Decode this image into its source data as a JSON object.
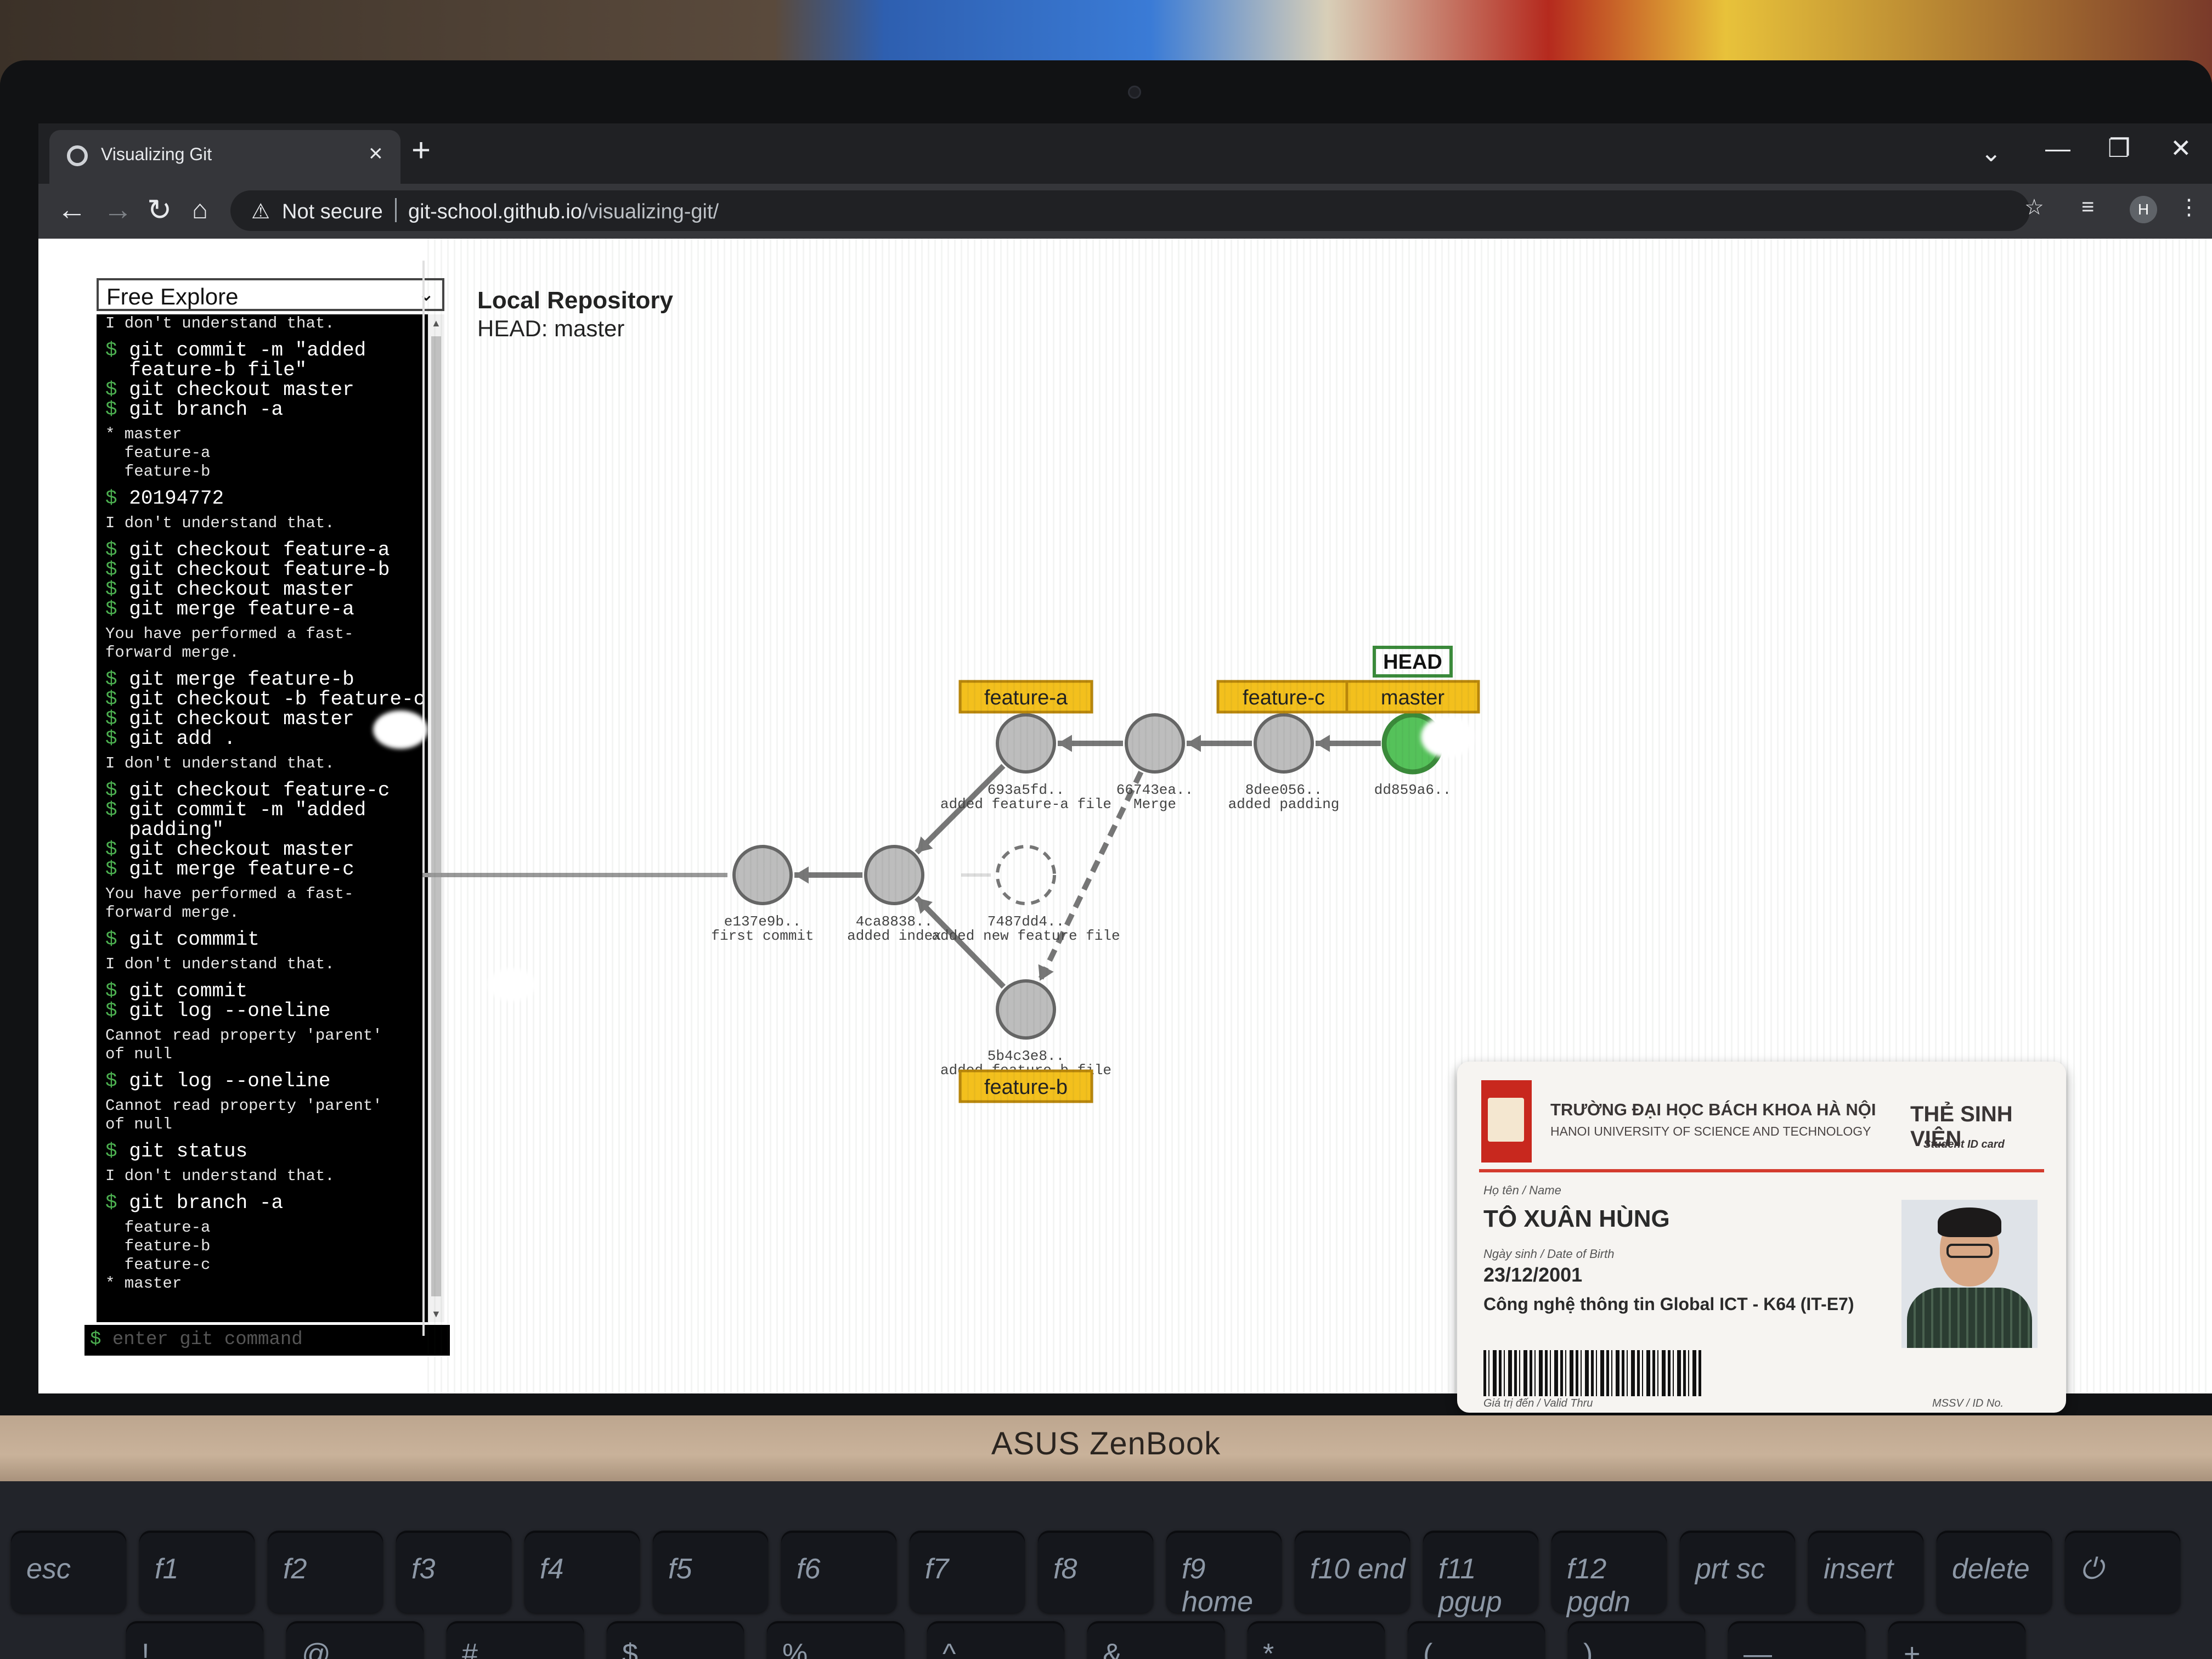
{
  "browser": {
    "tab_title": "Visualizing Git",
    "tab_close": "×",
    "new_tab": "+",
    "security_label": "Not secure",
    "url_host": "git-school.github.io",
    "url_path": "/visualizing-git/",
    "profile_initial": "H"
  },
  "app": {
    "mode_selected": "Free Explore",
    "input_placeholder": "enter git command",
    "terminal": [
      {
        "kind": "out",
        "text": "I don't understand that."
      },
      {
        "kind": "cmd",
        "text": "git commit -m \"added"
      },
      {
        "kind": "cont",
        "text": "feature-b file\""
      },
      {
        "kind": "cmd",
        "text": "git checkout master"
      },
      {
        "kind": "cmd",
        "text": "git branch -a"
      },
      {
        "kind": "out",
        "text": "* master"
      },
      {
        "kind": "out",
        "text": "  feature-a"
      },
      {
        "kind": "out",
        "text": "  feature-b"
      },
      {
        "kind": "cmd",
        "text": "20194772"
      },
      {
        "kind": "out",
        "text": "I don't understand that."
      },
      {
        "kind": "cmd",
        "text": "git checkout feature-a"
      },
      {
        "kind": "cmd",
        "text": "git checkout feature-b"
      },
      {
        "kind": "cmd",
        "text": "git checkout master"
      },
      {
        "kind": "cmd",
        "text": "git merge feature-a"
      },
      {
        "kind": "out",
        "text": "You have performed a fast-"
      },
      {
        "kind": "out",
        "text": "forward merge."
      },
      {
        "kind": "cmd",
        "text": "git merge feature-b"
      },
      {
        "kind": "cmd",
        "text": "git checkout -b feature-c"
      },
      {
        "kind": "cmd",
        "text": "git checkout master"
      },
      {
        "kind": "cmd",
        "text": "git add ."
      },
      {
        "kind": "out",
        "text": "I don't understand that."
      },
      {
        "kind": "cmd",
        "text": "git checkout feature-c"
      },
      {
        "kind": "cmd",
        "text": "git commit -m \"added"
      },
      {
        "kind": "cont",
        "text": "padding\""
      },
      {
        "kind": "cmd",
        "text": "git checkout master"
      },
      {
        "kind": "cmd",
        "text": "git merge feature-c"
      },
      {
        "kind": "out",
        "text": "You have performed a fast-"
      },
      {
        "kind": "out",
        "text": "forward merge."
      },
      {
        "kind": "cmd",
        "text": "git commmit"
      },
      {
        "kind": "out",
        "text": "I don't understand that."
      },
      {
        "kind": "cmd",
        "text": "git commit"
      },
      {
        "kind": "cmd",
        "text": "git log --oneline"
      },
      {
        "kind": "out",
        "text": "Cannot read property 'parent'"
      },
      {
        "kind": "out",
        "text": "of null"
      },
      {
        "kind": "cmd",
        "text": "git log --oneline"
      },
      {
        "kind": "out",
        "text": "Cannot read property 'parent'"
      },
      {
        "kind": "out",
        "text": "of null"
      },
      {
        "kind": "cmd",
        "text": "git status"
      },
      {
        "kind": "out",
        "text": "I don't understand that."
      },
      {
        "kind": "cmd",
        "text": "git branch -a"
      },
      {
        "kind": "out",
        "text": "  feature-a"
      },
      {
        "kind": "out",
        "text": "  feature-b"
      },
      {
        "kind": "out",
        "text": "  feature-c"
      },
      {
        "kind": "out",
        "text": "* master"
      }
    ]
  },
  "repo": {
    "title": "Local Repository",
    "head_line": "HEAD: master",
    "head_label": "HEAD",
    "commits": [
      {
        "id": "e137e9b..",
        "msg": "first commit",
        "current": false,
        "dashed": false
      },
      {
        "id": "4ca8838..",
        "msg": "added index",
        "current": false,
        "dashed": false
      },
      {
        "id": "7487dd4..",
        "msg": "added new feature file",
        "current": false,
        "dashed": true
      },
      {
        "id": "693a5fd..",
        "msg": "added feature-a file",
        "current": false,
        "dashed": false
      },
      {
        "id": "5b4c3e8..",
        "msg": "added feature-b file",
        "current": false,
        "dashed": false
      },
      {
        "id": "66743ea..",
        "msg": "Merge",
        "current": false,
        "dashed": false
      },
      {
        "id": "8dee056..",
        "msg": "added padding",
        "current": false,
        "dashed": false
      },
      {
        "id": "dd859a6..",
        "msg": "",
        "current": true,
        "dashed": false
      }
    ],
    "branches": [
      {
        "name": "feature-a"
      },
      {
        "name": "feature-c"
      },
      {
        "name": "master"
      },
      {
        "name": "feature-b"
      }
    ],
    "colors": {
      "branch_fill": "#f3c01d",
      "commit_fill": "#bdbdbd",
      "current_fill": "#55c25a",
      "head_border": "#3a8a3a"
    }
  },
  "id_card": {
    "university_vi": "TRƯỜNG ĐẠI HỌC BÁCH KHOA HÀ NỘI",
    "university_en": "HANOI UNIVERSITY OF SCIENCE AND TECHNOLOGY",
    "card_type_vi": "THẺ SINH VIÊN",
    "card_type_en": "Student ID card",
    "name_label": "Họ tên / Name",
    "name": "TÔ XUÂN HÙNG",
    "dob_label": "Ngày sinh / Date of Birth",
    "dob": "23/12/2001",
    "major": "Công nghệ thông tin Global ICT - K64 (IT-E7)",
    "valid_label": "Giá trị đến / Valid Thru",
    "id_label": "MSSV / ID No."
  },
  "laptop": {
    "brand": "ASUS ZenBook",
    "keys": [
      {
        "label": "esc"
      },
      {
        "label": "f1"
      },
      {
        "label": "f2"
      },
      {
        "label": "f3"
      },
      {
        "label": "f4"
      },
      {
        "label": "f5"
      },
      {
        "label": "f6"
      },
      {
        "label": "f7"
      },
      {
        "label": "f8"
      },
      {
        "label": "f9 home"
      },
      {
        "label": "f10 end"
      },
      {
        "label": "f11 pgup"
      },
      {
        "label": "f12 pgdn"
      },
      {
        "label": "prt sc"
      },
      {
        "label": "insert"
      },
      {
        "label": "delete"
      },
      {
        "label": "⏻"
      }
    ],
    "keys_row2": [
      {
        "label": "!"
      },
      {
        "label": "@"
      },
      {
        "label": "#"
      },
      {
        "label": "$"
      },
      {
        "label": "%"
      },
      {
        "label": "^"
      },
      {
        "label": "&"
      },
      {
        "label": "*"
      },
      {
        "label": "("
      },
      {
        "label": ")"
      },
      {
        "label": "—"
      },
      {
        "label": "+"
      }
    ]
  }
}
